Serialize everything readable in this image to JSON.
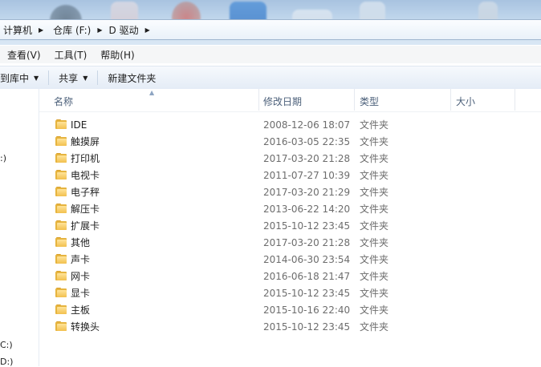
{
  "address_bar": {
    "crumbs": [
      "计算机",
      "仓库 (F:)",
      "D 驱动"
    ]
  },
  "menu": {
    "items": [
      "查看(V)",
      "工具(T)",
      "帮助(H)"
    ]
  },
  "commands": {
    "include_library": "到库中",
    "share": "共享",
    "new_folder": "新建文件夹"
  },
  "columns": {
    "name": "名称",
    "date": "修改日期",
    "type": "类型",
    "size": "大小"
  },
  "nav_fragments": [
    "(",
    ":)",
    "C:)",
    "D:)"
  ],
  "files": [
    {
      "name": "IDE",
      "date": "2008-12-06 18:07",
      "type": "文件夹"
    },
    {
      "name": "触摸屏",
      "date": "2016-03-05 22:35",
      "type": "文件夹"
    },
    {
      "name": "打印机",
      "date": "2017-03-20 21:28",
      "type": "文件夹"
    },
    {
      "name": "电视卡",
      "date": "2011-07-27 10:39",
      "type": "文件夹"
    },
    {
      "name": "电子秤",
      "date": "2017-03-20 21:29",
      "type": "文件夹"
    },
    {
      "name": "解压卡",
      "date": "2013-06-22 14:20",
      "type": "文件夹"
    },
    {
      "name": "扩展卡",
      "date": "2015-10-12 23:45",
      "type": "文件夹"
    },
    {
      "name": "其他",
      "date": "2017-03-20 21:28",
      "type": "文件夹"
    },
    {
      "name": "声卡",
      "date": "2014-06-30 23:54",
      "type": "文件夹"
    },
    {
      "name": "网卡",
      "date": "2016-06-18 21:47",
      "type": "文件夹"
    },
    {
      "name": "显卡",
      "date": "2015-10-12 23:45",
      "type": "文件夹"
    },
    {
      "name": "主板",
      "date": "2015-10-16 22:40",
      "type": "文件夹"
    },
    {
      "name": "转换头",
      "date": "2015-10-12 23:45",
      "type": "文件夹"
    }
  ]
}
